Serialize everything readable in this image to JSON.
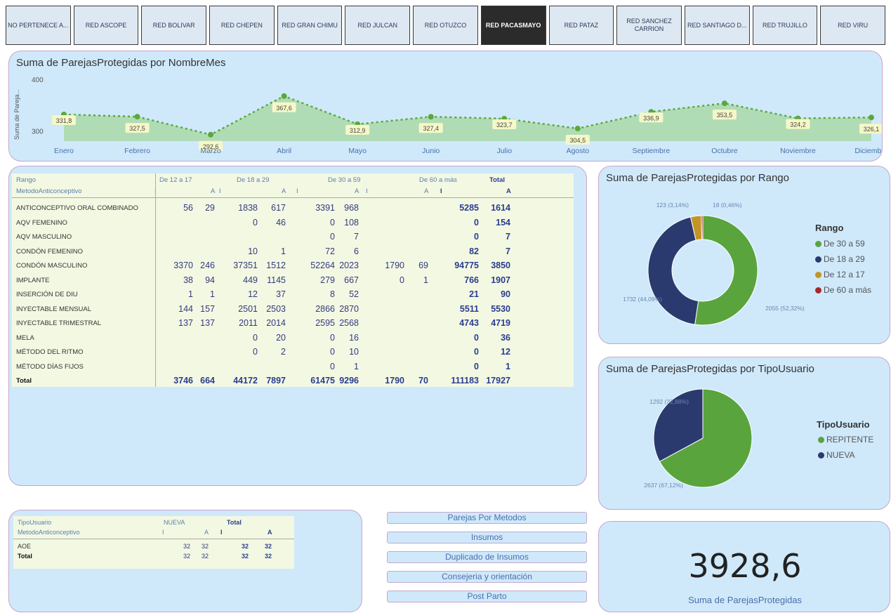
{
  "slicer": {
    "items": [
      "NO PERTENECE A...",
      "RED ASCOPE",
      "RED BOLIVAR",
      "RED CHEPEN",
      "RED GRAN CHIMU",
      "RED JULCAN",
      "RED OTUZCO",
      "RED PACASMAYO",
      "RED PATAZ",
      "RED SANCHEZ CARRION",
      "RED SANTIAGO D...",
      "RED TRUJILLO",
      "RED VIRU"
    ],
    "active": "RED PACASMAYO"
  },
  "line_chart": {
    "title": "Suma de ParejasProtegidas por NombreMes",
    "ylabel": "Suma de Pareja...",
    "tick_labels": [
      "400",
      "300"
    ]
  },
  "chart_data": [
    {
      "type": "line",
      "title": "Suma de ParejasProtegidas por NombreMes",
      "xlabel": "",
      "ylabel": "Suma de Pareja...",
      "categories": [
        "Enero",
        "Febrero",
        "Marzo",
        "Abril",
        "Mayo",
        "Junio",
        "Julio",
        "Agosto",
        "Septiembre",
        "Octubre",
        "Noviembre",
        "Diciembre"
      ],
      "values": [
        331.8,
        327.5,
        292.6,
        367.6,
        312.9,
        327.4,
        323.7,
        304.5,
        336.9,
        353.5,
        324.2,
        326.1
      ],
      "data_labels": [
        "331,8",
        "327,5",
        "292,6",
        "367,6",
        "312,9",
        "327,4",
        "323,7",
        "304,5",
        "336,9",
        "353,5",
        "324,2",
        "326,1"
      ],
      "ylim": [
        280,
        400
      ],
      "yticks": [
        300,
        400
      ],
      "color": "#5ba83a",
      "area_color": "#a7d8a4"
    },
    {
      "type": "pie",
      "title": "Suma de ParejasProtegidas por Rango",
      "legend_title": "Rango",
      "donut": true,
      "labels": [
        "De 30 a 59",
        "De 18 a 29",
        "De 12 a 17",
        "De 60 a más"
      ],
      "values": [
        2055,
        1732,
        123,
        18
      ],
      "slice_labels": [
        "2055 (52,32%)",
        "1732 (44,09%)",
        "123 (3,14%)",
        "18 (0,46%)"
      ],
      "colors": [
        "#5aa43e",
        "#2b3a6e",
        "#c29526",
        "#a52a2a"
      ],
      "legend": "right"
    },
    {
      "type": "pie",
      "title": "Suma de ParejasProtegidas por TipoUsuario",
      "legend_title": "TipoUsuario",
      "donut": false,
      "labels": [
        "REPITENTE",
        "NUEVA"
      ],
      "values": [
        2637,
        1292
      ],
      "slice_labels": [
        "2637 (67,12%)",
        "1292 (32,88%)"
      ],
      "colors": [
        "#5aa43e",
        "#2b3a6e"
      ],
      "legend": "right"
    }
  ],
  "matrix1": {
    "row_header_1": "Rango",
    "row_header_2": "MetodoAnticonceptivo",
    "groups": [
      "De 12 a 17",
      "De 18 a 29",
      "De 30 a 59",
      "De 60 a más",
      "Total"
    ],
    "sub": [
      "I",
      "A"
    ],
    "rows": [
      {
        "label": "ANTICONCEPTIVO ORAL COMBINADO",
        "cells": [
          "56",
          "29",
          "1838",
          "617",
          "3391",
          "968",
          "",
          "",
          "5285",
          "1614"
        ]
      },
      {
        "label": "AQV FEMENINO",
        "cells": [
          "",
          "",
          "0",
          "46",
          "0",
          "108",
          "",
          "",
          "0",
          "154"
        ]
      },
      {
        "label": "AQV MASCULINO",
        "cells": [
          "",
          "",
          "",
          "",
          "0",
          "7",
          "",
          "",
          "0",
          "7"
        ]
      },
      {
        "label": "CONDÓN FEMENINO",
        "cells": [
          "",
          "",
          "10",
          "1",
          "72",
          "6",
          "",
          "",
          "82",
          "7"
        ]
      },
      {
        "label": "CONDÓN MASCULINO",
        "cells": [
          "3370",
          "246",
          "37351",
          "1512",
          "52264",
          "2023",
          "1790",
          "69",
          "94775",
          "3850"
        ]
      },
      {
        "label": "IMPLANTE",
        "cells": [
          "38",
          "94",
          "449",
          "1145",
          "279",
          "667",
          "0",
          "1",
          "766",
          "1907"
        ]
      },
      {
        "label": "INSERCIÓN DE DIU",
        "cells": [
          "1",
          "1",
          "12",
          "37",
          "8",
          "52",
          "",
          "",
          "21",
          "90"
        ]
      },
      {
        "label": "INYECTABLE MENSUAL",
        "cells": [
          "144",
          "157",
          "2501",
          "2503",
          "2866",
          "2870",
          "",
          "",
          "5511",
          "5530"
        ]
      },
      {
        "label": "INYECTABLE TRIMESTRAL",
        "cells": [
          "137",
          "137",
          "2011",
          "2014",
          "2595",
          "2568",
          "",
          "",
          "4743",
          "4719"
        ]
      },
      {
        "label": "MELA",
        "cells": [
          "",
          "",
          "0",
          "20",
          "0",
          "16",
          "",
          "",
          "0",
          "36"
        ]
      },
      {
        "label": "MÉTODO DEL RITMO",
        "cells": [
          "",
          "",
          "0",
          "2",
          "0",
          "10",
          "",
          "",
          "0",
          "12"
        ]
      },
      {
        "label": "MÉTODO DÍAS FIJOS",
        "cells": [
          "",
          "",
          "",
          "",
          "0",
          "1",
          "",
          "",
          "0",
          "1"
        ]
      }
    ],
    "total_row": {
      "label": "Total",
      "cells": [
        "3746",
        "664",
        "44172",
        "7897",
        "61475",
        "9296",
        "1790",
        "70",
        "111183",
        "17927"
      ]
    }
  },
  "matrix2": {
    "row_header_1": "TipoUsuario",
    "row_header_2": "MetodoAnticonceptivo",
    "groups": [
      "NUEVA",
      "Total"
    ],
    "sub": [
      "I",
      "A"
    ],
    "rows": [
      {
        "label": "AOE",
        "cells": [
          "32",
          "32",
          "32",
          "32"
        ]
      }
    ],
    "total_row": {
      "label": "Total",
      "cells": [
        "32",
        "32",
        "32",
        "32"
      ]
    }
  },
  "links": [
    "Parejas Por Metodos",
    "Insumos",
    "Duplicado de Insumos",
    "Consejeria y orientación",
    "Post Parto"
  ],
  "kpi": {
    "value": "3928,6",
    "label": "Suma de ParejasProtegidas"
  }
}
